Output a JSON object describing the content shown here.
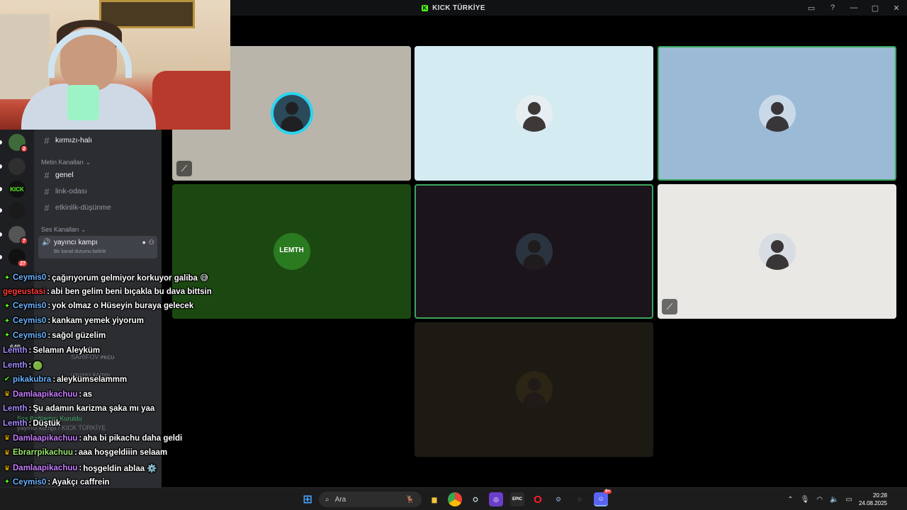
{
  "window": {
    "title": "KICK TÜRKİYE",
    "title_logo": "K"
  },
  "rail": {
    "servers": [
      {
        "badge": "2",
        "bg": "#3f6b3a"
      },
      {
        "badge": "",
        "bg": "#2f2f2f"
      },
      {
        "label": "KICK",
        "badge": "",
        "bg": "#111111"
      },
      {
        "badge": "",
        "bg": "#1a1a1a"
      },
      {
        "badge": "7",
        "bg": "#555555"
      },
      {
        "badge": "27",
        "bg": "#111111"
      }
    ]
  },
  "channels": {
    "top_channel": "kırmızı-halı",
    "text_category": "Metin Kanalları",
    "text_channels": [
      "genel",
      "link-odası",
      "etkinlik-düşünme"
    ],
    "voice_category": "Ses Kanalları",
    "voice_channel": "yayıncı kampı",
    "voice_status": "Bir kanal durumu belirle",
    "faded": {
      "vc2": "yayıncı kampı",
      "user": "SARIFOV",
      "user_tag": "PKCU",
      "connected": "Ses Bağlantısı Kuruldu",
      "server": "yayıncı kampı / KICK TÜRKİYE",
      "count": "649"
    }
  },
  "chat": [
    {
      "icon": "diamond",
      "user": "Ceymis0",
      "color": "#6bb3ff",
      "text": "çağırıyorum gelmiyor korkuyor galiba 😅"
    },
    {
      "icon": "",
      "user": "gegeustasi",
      "color": "#ff3b3b",
      "text": "abi ben gelim beni bıçakla bu dava bittsin"
    },
    {
      "icon": "diamond",
      "user": "Ceymis0",
      "color": "#6bb3ff",
      "text": "yok olmaz o Hüseyin buraya gelecek"
    },
    {
      "icon": "diamond",
      "user": "Ceymis0",
      "color": "#6bb3ff",
      "text": "kankam yemek yiyorum"
    },
    {
      "icon": "diamond",
      "user": "Ceymis0",
      "color": "#6bb3ff",
      "text": "sağol güzelim"
    },
    {
      "icon": "",
      "user": "Lemth",
      "color": "#a58bff",
      "text": "Selamın Aleyküm"
    },
    {
      "icon": "",
      "user": "Lemth",
      "color": "#a58bff",
      "text": "🟢"
    },
    {
      "icon": "check",
      "user": "pikakubra",
      "color": "#6bb3ff",
      "text": "aleykümselammm"
    },
    {
      "icon": "crown",
      "user": "Damlaapikachuu",
      "color": "#c77dff",
      "text": "as"
    },
    {
      "icon": "",
      "user": "Lemth",
      "color": "#a58bff",
      "text": "Şu adamın karizma şaka mı yaa"
    },
    {
      "icon": "",
      "user": "Lemth",
      "color": "#a58bff",
      "text": "Düştük"
    },
    {
      "icon": "crown",
      "user": "Damlaapikachuu",
      "color": "#c77dff",
      "text": "aha bi pikachu daha geldi"
    },
    {
      "icon": "crown",
      "user": "Ebrarrpikachuu",
      "color": "#9be870",
      "text": "aaa hoşgeldiiin selaam"
    },
    {
      "icon": "crown",
      "user": "Damlaapikachuu",
      "color": "#c77dff",
      "text": "hoşgeldin ablaa ⚙️"
    },
    {
      "icon": "diamond",
      "user": "Ceymis0",
      "color": "#6bb3ff",
      "text": "Ayakçı caffrein"
    }
  ],
  "tiles": [
    {
      "name": "tile-1",
      "bg": "#b9b5ab",
      "avatar_bg": "#2a4a5a",
      "ring": "#2ad4f0",
      "muted": true,
      "speaking": false
    },
    {
      "name": "tile-2",
      "bg": "#d4ebf2",
      "avatar_bg": "#e6eef2",
      "muted": false,
      "speaking": false
    },
    {
      "name": "tile-3",
      "bg": "#9bbad6",
      "avatar_bg": "#c9d9e8",
      "muted": false,
      "speaking": true
    },
    {
      "name": "tile-4",
      "bg": "#1b4810",
      "avatar_bg": "#2a7a20",
      "label": "LEMTH",
      "muted": false,
      "speaking": false
    },
    {
      "name": "tile-5",
      "bg": "#1c141b",
      "avatar_bg": "#2a3440",
      "muted": false,
      "speaking": true
    },
    {
      "name": "tile-6",
      "bg": "#e9e8e5",
      "avatar_bg": "#d8dde3",
      "muted": true,
      "speaking": false
    },
    {
      "name": "tile-7",
      "bg": "#1c1a12",
      "avatar_bg": "#2c2414",
      "muted": false,
      "speaking": false
    }
  ],
  "taskbar": {
    "search_placeholder": "Ara",
    "time": "20:28",
    "date": "24.08.2025",
    "discord_badge": "9+"
  }
}
